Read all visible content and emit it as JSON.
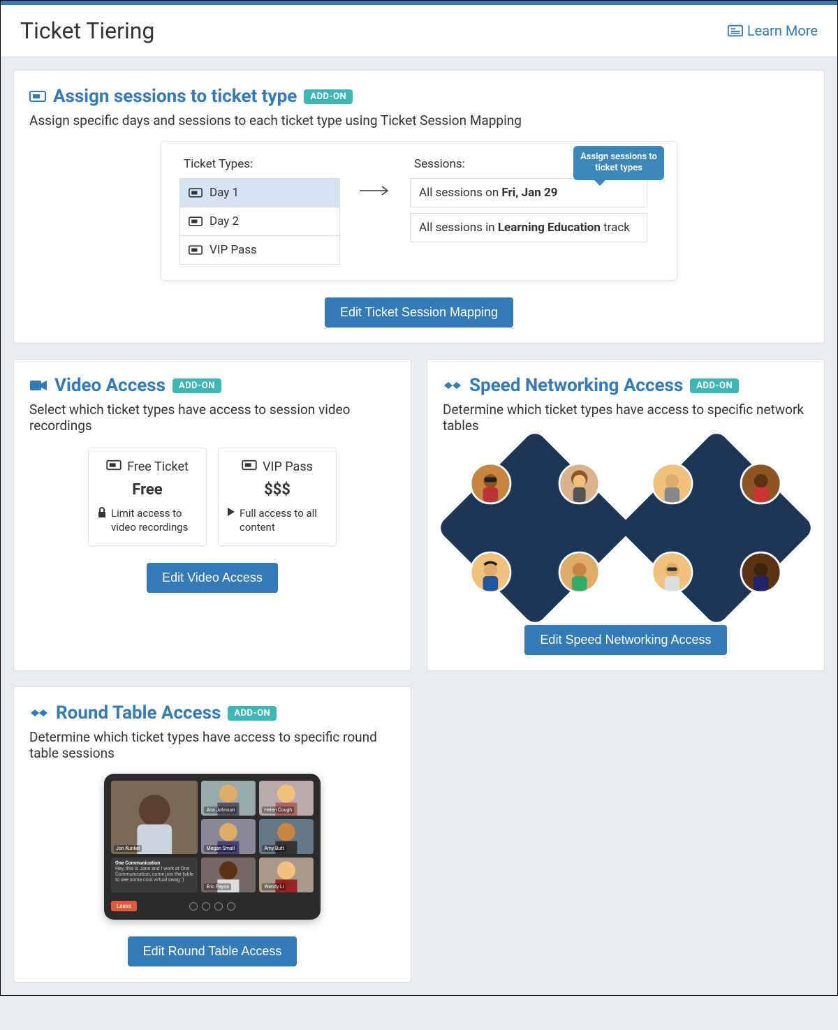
{
  "header": {
    "title": "Ticket Tiering",
    "learn_more": "Learn More"
  },
  "badge": {
    "addon": "ADD-ON"
  },
  "assign": {
    "title": "Assign sessions to ticket type",
    "desc": "Assign specific days and sessions to each ticket type using Ticket Session Mapping",
    "ticket_types_label": "Ticket Types:",
    "sessions_label": "Sessions:",
    "ticket_types": [
      "Day 1",
      "Day 2",
      "VIP Pass"
    ],
    "session_prefix_1": "All sessions on ",
    "session_bold_1": "Fri, Jan 29",
    "session_prefix_2": "All sessions in ",
    "session_bold_2": "Learning Education",
    "session_suffix_2": " track",
    "bubble": "Assign sessions to ticket types",
    "button": "Edit Ticket Session Mapping"
  },
  "video": {
    "title": "Video Access",
    "desc": "Select which ticket types have access to session video recordings",
    "card1": {
      "name": "Free Ticket",
      "price": "Free",
      "note": "Limit access to video recordings"
    },
    "card2": {
      "name": "VIP Pass",
      "price": "$$$",
      "note": "Full access to all content"
    },
    "button": "Edit Video Access"
  },
  "speed": {
    "title": "Speed Networking Access",
    "desc": "Determine which ticket types have access to specific network tables",
    "button": "Edit Speed Networking Access"
  },
  "round": {
    "title": "Round Table Access",
    "desc": "Determine which ticket types have access to specific round table sessions",
    "button": "Edit Round Table Access"
  }
}
